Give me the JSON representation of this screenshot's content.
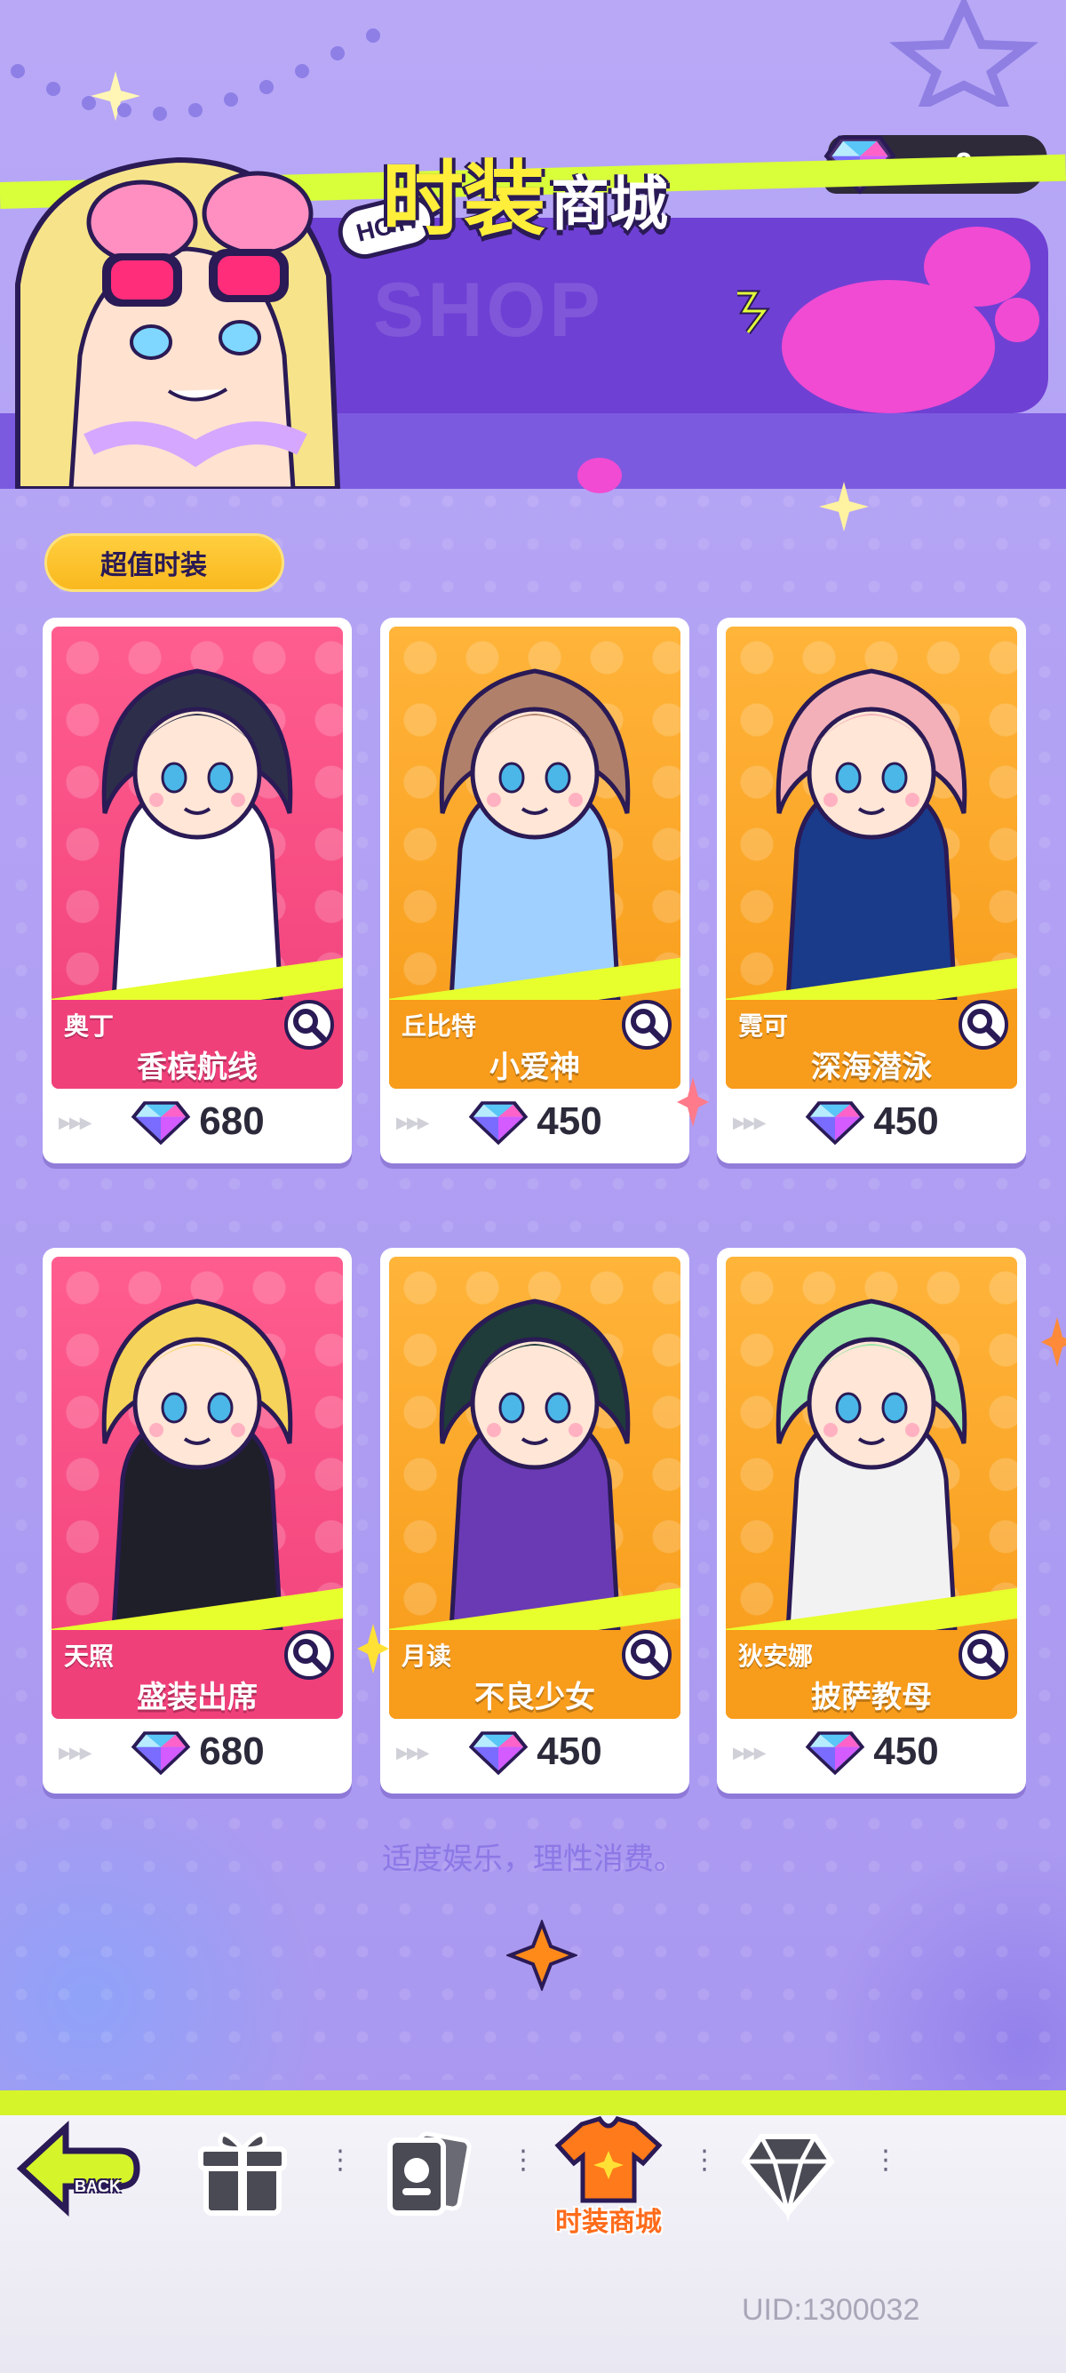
{
  "header": {
    "gem_balance": "0",
    "hot_badge": "HOT!",
    "watermark": "SHOP",
    "title_big": "时装",
    "title_small": "商城"
  },
  "section": {
    "label": "超值时装"
  },
  "cards": [
    {
      "character": "奥丁",
      "outfit": "香槟航线",
      "price": "680",
      "theme": "pink"
    },
    {
      "character": "丘比特",
      "outfit": "小爱神",
      "price": "450",
      "theme": "orange"
    },
    {
      "character": "霓可",
      "outfit": "深海潜泳",
      "price": "450",
      "theme": "orange"
    },
    {
      "character": "天照",
      "outfit": "盛装出席",
      "price": "680",
      "theme": "pink"
    },
    {
      "character": "月读",
      "outfit": "不良少女",
      "price": "450",
      "theme": "orange"
    },
    {
      "character": "狄安娜",
      "outfit": "披萨教母",
      "price": "450",
      "theme": "orange"
    }
  ],
  "notice": "适度娱乐，理性消费。",
  "nav": {
    "back_label": "BACK",
    "active_label": "时装商城",
    "items": [
      "back",
      "gift",
      "cards",
      "outfit-shop",
      "diamond"
    ]
  },
  "uid": "UID:1300032",
  "colors": {
    "background": "#b3a4f5",
    "accent_yellow": "#ffef3a",
    "neon_green": "#d8ff3a",
    "card_pink": "#f0407a",
    "card_orange": "#f89c1c",
    "active_nav": "#ff6b1a"
  }
}
